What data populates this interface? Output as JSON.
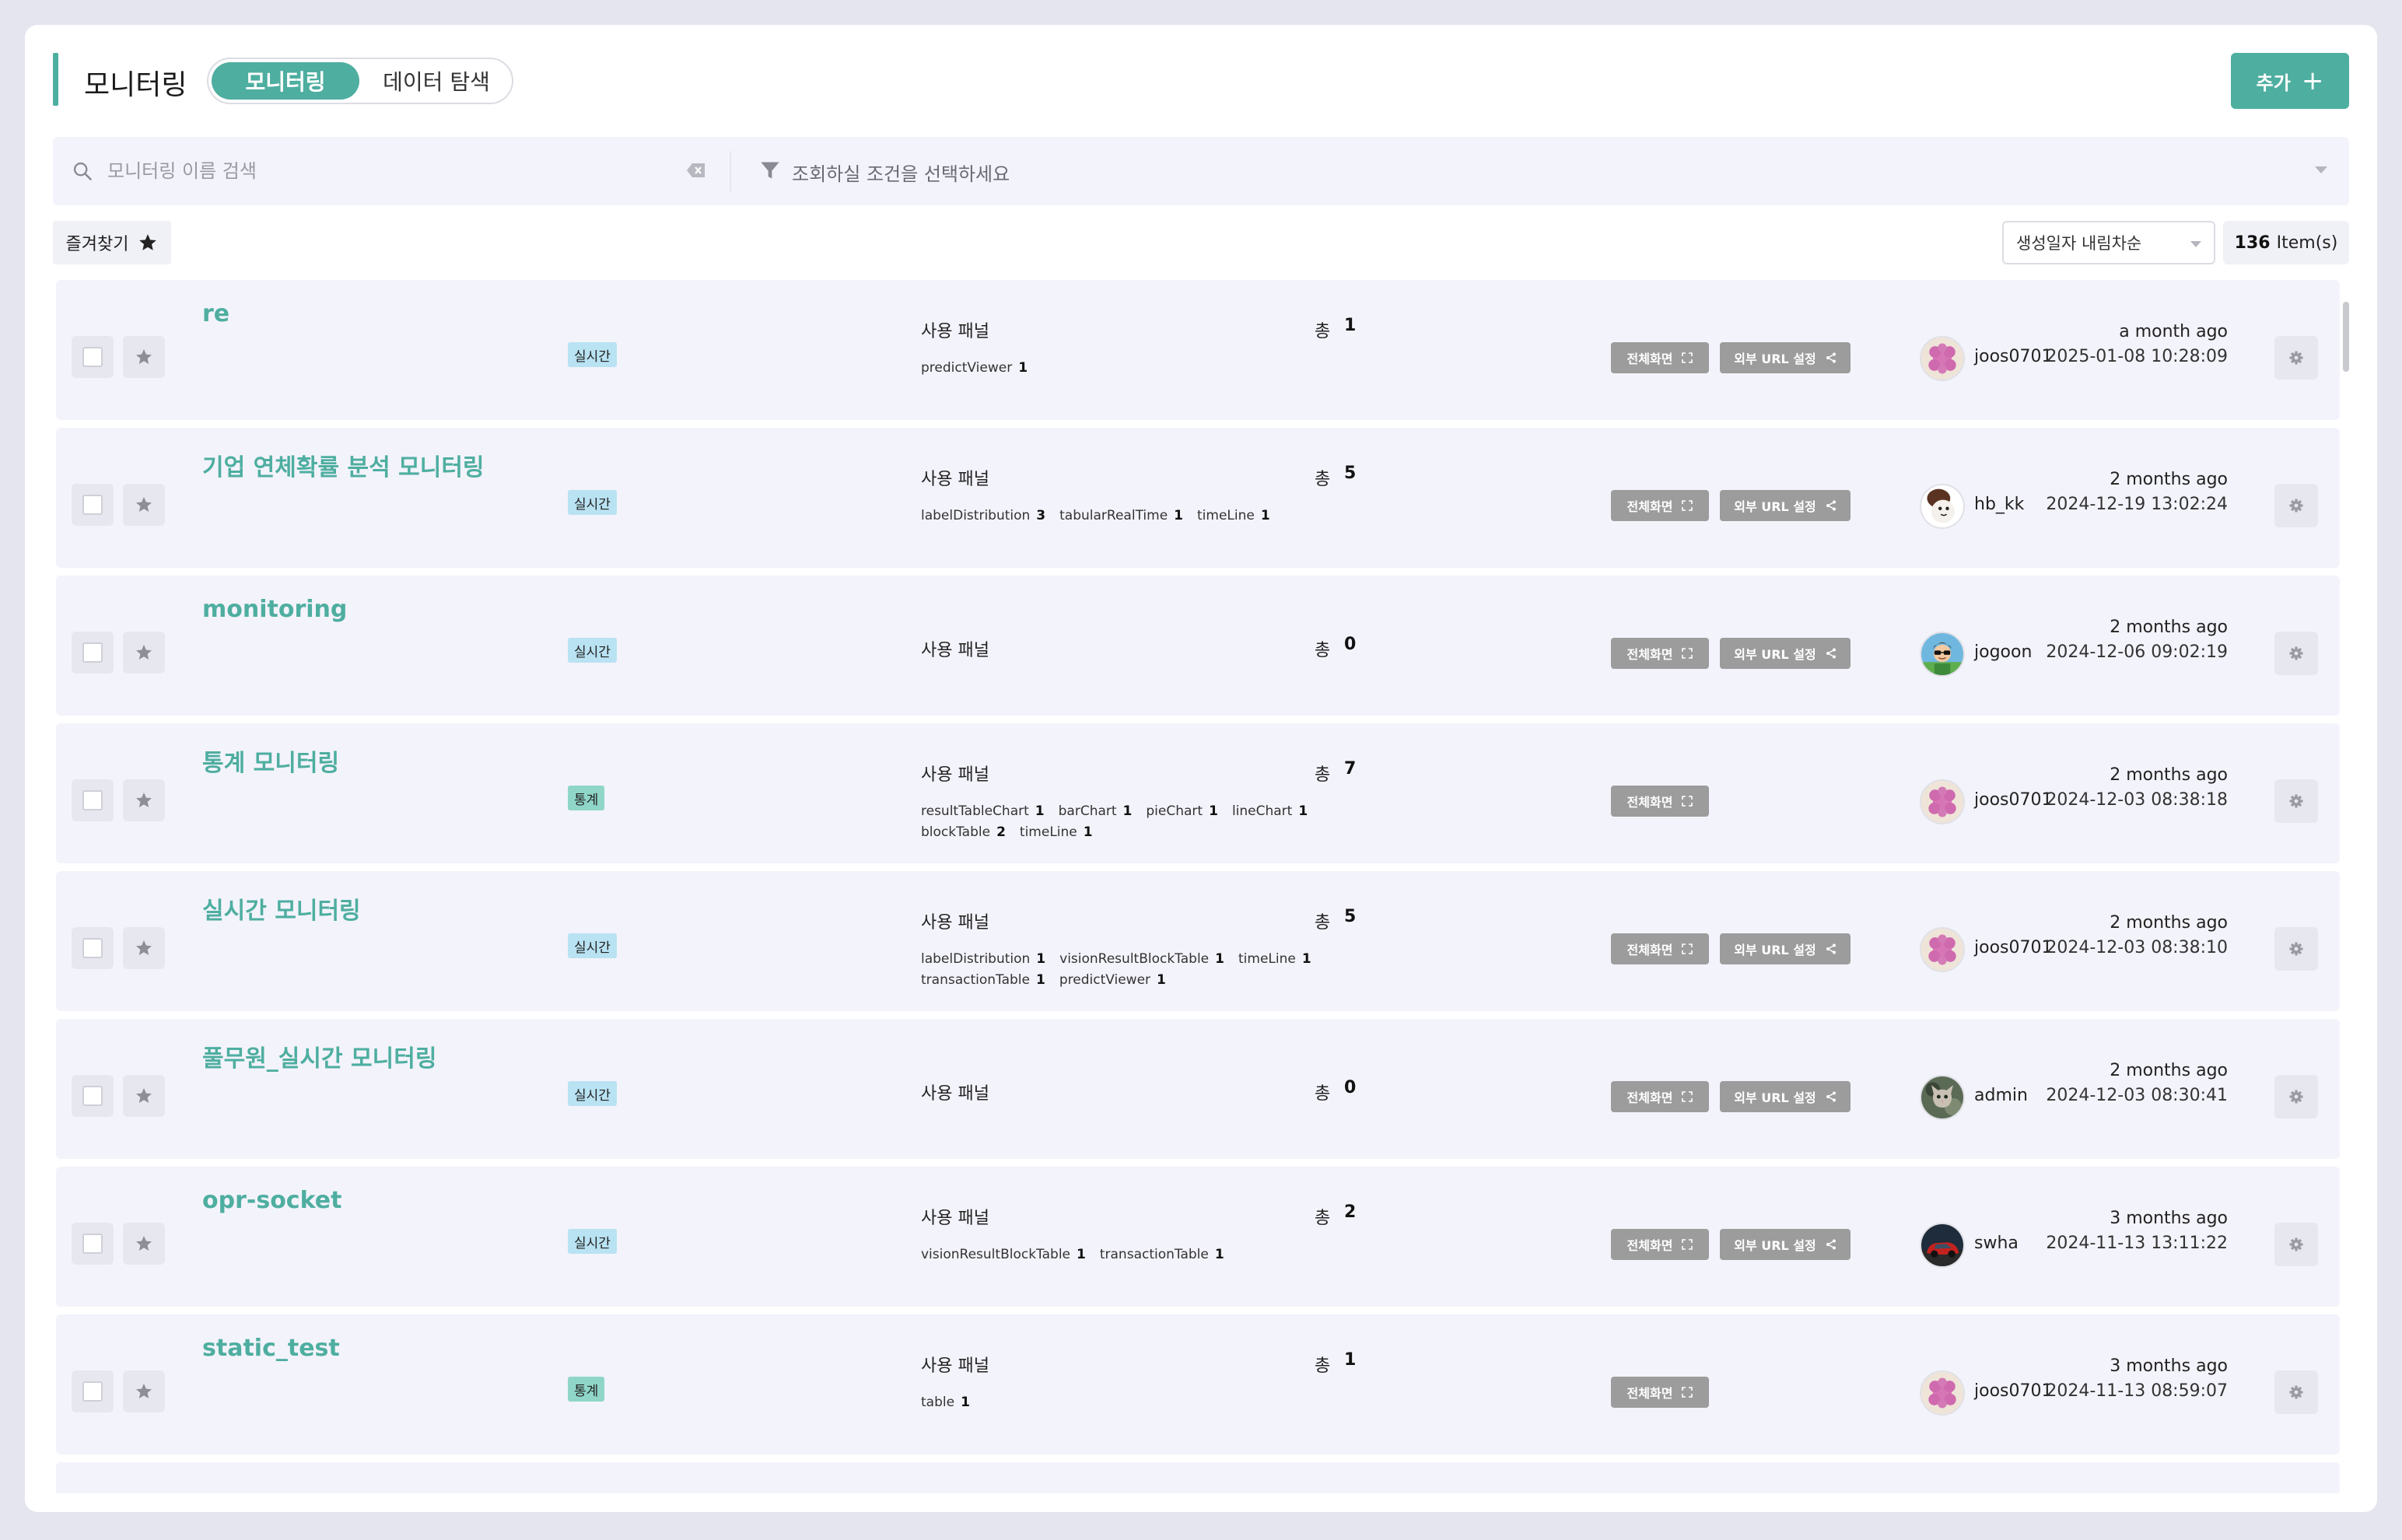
{
  "header": {
    "title": "모니터링",
    "modes": [
      "모니터링",
      "데이터 탐색"
    ],
    "add_label": "추가"
  },
  "search": {
    "placeholder": "모니터링 이름 검색",
    "filter_placeholder": "조회하실 조건을 선택하세요"
  },
  "toolbar": {
    "favorites_label": "즐겨찾기",
    "sort_value": "생성일자 내림차순",
    "item_count": "136",
    "item_unit": "Item(s)"
  },
  "labels": {
    "panel": "사용 패널",
    "total": "총",
    "fullscreen": "전체화면",
    "external_url": "외부 URL 설정"
  },
  "rows": [
    {
      "name": "re",
      "type": "실시간",
      "total": "1",
      "chips": [
        {
          "n": "predictViewer",
          "c": "1"
        }
      ],
      "user": "joos0701",
      "avatar": "flower",
      "rel": "a month ago",
      "abs": "2025-01-08 10:28:09",
      "url": true
    },
    {
      "name": " 기업 연체확률 분석 모니터링",
      "type": "실시간",
      "total": "5",
      "chips": [
        {
          "n": "labelDistribution",
          "c": "3"
        },
        {
          "n": "tabularRealTime",
          "c": "1"
        },
        {
          "n": "timeLine",
          "c": "1"
        }
      ],
      "user": "hb_kk",
      "avatar": "character",
      "rel": "2 months ago",
      "abs": "2024-12-19 13:02:24",
      "url": true
    },
    {
      "name": "monitoring",
      "type": "실시간",
      "total": "0",
      "chips": [],
      "user": "jogoon",
      "avatar": "person",
      "rel": "2 months ago",
      "abs": "2024-12-06 09:02:19",
      "url": true
    },
    {
      "name": "통계 모니터링",
      "type": "통계",
      "total": "7",
      "chips": [
        {
          "n": "resultTableChart",
          "c": "1"
        },
        {
          "n": "barChart",
          "c": "1"
        },
        {
          "n": "pieChart",
          "c": "1"
        },
        {
          "n": "lineChart",
          "c": "1"
        },
        {
          "n": "blockTable",
          "c": "2"
        },
        {
          "n": "timeLine",
          "c": "1"
        }
      ],
      "user": "joos0701",
      "avatar": "flower",
      "rel": "2 months ago",
      "abs": "2024-12-03 08:38:18",
      "url": false
    },
    {
      "name": "실시간 모니터링",
      "type": "실시간",
      "total": "5",
      "chips": [
        {
          "n": "labelDistribution",
          "c": "1"
        },
        {
          "n": "visionResultBlockTable",
          "c": "1"
        },
        {
          "n": "timeLine",
          "c": "1"
        },
        {
          "n": "transactionTable",
          "c": "1"
        },
        {
          "n": "predictViewer",
          "c": "1"
        }
      ],
      "user": "joos0701",
      "avatar": "flower",
      "rel": "2 months ago",
      "abs": "2024-12-03 08:38:10",
      "url": true
    },
    {
      "name": "풀무원_실시간 모니터링",
      "type": "실시간",
      "total": "0",
      "chips": [],
      "user": "admin",
      "avatar": "cat",
      "rel": "2 months ago",
      "abs": "2024-12-03 08:30:41",
      "url": true
    },
    {
      "name": "opr-socket",
      "type": "실시간",
      "total": "2",
      "chips": [
        {
          "n": "visionResultBlockTable",
          "c": "1"
        },
        {
          "n": "transactionTable",
          "c": "1"
        }
      ],
      "user": "swha",
      "avatar": "car",
      "rel": "3 months ago",
      "abs": "2024-11-13 13:11:22",
      "url": true
    },
    {
      "name": "static_test",
      "type": "통계",
      "total": "1",
      "chips": [
        {
          "n": "table",
          "c": "1"
        }
      ],
      "user": "joos0701",
      "avatar": "flower",
      "rel": "3 months ago",
      "abs": "2024-11-13 08:59:07",
      "url": false
    }
  ],
  "colors": {
    "accent": "#4eaea0",
    "realtime_badge": "#b9e2f2",
    "stat_badge": "#8fd6c8",
    "action_button": "#9c9c9c"
  }
}
